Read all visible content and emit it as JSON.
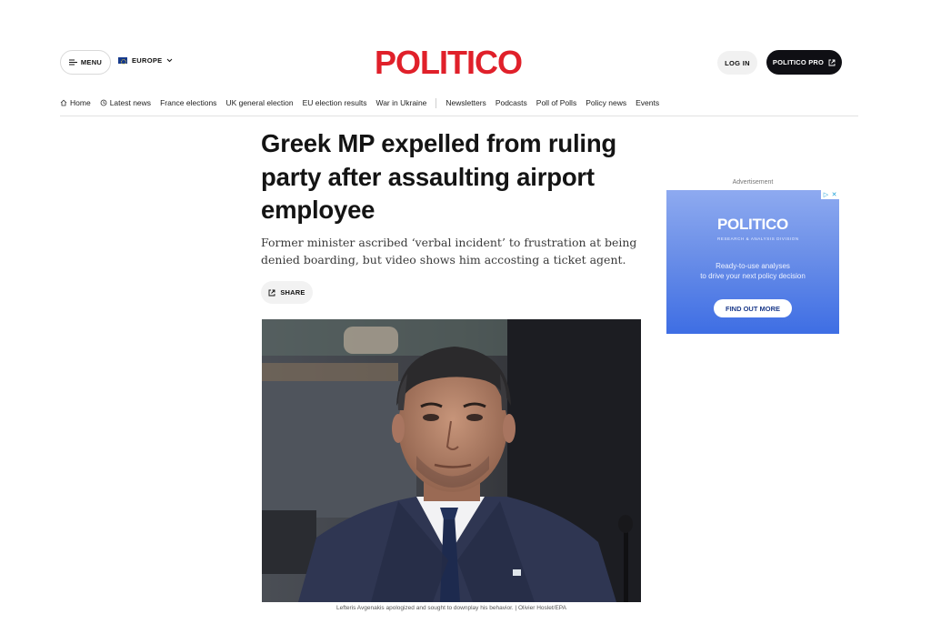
{
  "header": {
    "menu_label": "MENU",
    "region_label": "EUROPE",
    "logo_text": "POLITICO",
    "login_label": "LOG IN",
    "pro_label": "POLITICO PRO",
    "brand_color": "#e0202a"
  },
  "nav": {
    "items": [
      {
        "label": "Home",
        "icon": "home-icon"
      },
      {
        "label": "Latest news",
        "icon": "clock-icon"
      },
      {
        "label": "France elections"
      },
      {
        "label": "UK general election"
      },
      {
        "label": "EU election results"
      },
      {
        "label": "War in Ukraine"
      },
      {
        "label": "Newsletters"
      },
      {
        "label": "Podcasts"
      },
      {
        "label": "Poll of Polls"
      },
      {
        "label": "Policy news"
      },
      {
        "label": "Events"
      }
    ]
  },
  "article": {
    "headline": "Greek MP expelled from ruling party after assaulting airport employee",
    "dek": "Former minister ascribed ‘verbal incident’ to frustration at being denied boarding, but video shows him accosting a ticket agent.",
    "share_label": "SHARE",
    "caption": "Lefteris Avgenakis apologized and sought to downplay his behavior. | Olivier Hoslet/EPA"
  },
  "ad": {
    "label": "Advertisement",
    "logo": "POLITICO",
    "sub": "RESEARCH & ANALYSIS DIVISION",
    "text_line1": "Ready-to-use analyses",
    "text_line2": "to drive your next policy decision",
    "cta": "FIND OUT MORE"
  }
}
